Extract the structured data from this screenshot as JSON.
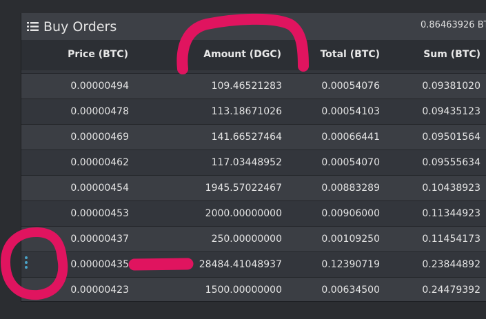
{
  "panel": {
    "title": "Buy Orders",
    "total": "0.86463926 BT",
    "icon": "list-icon"
  },
  "columns": [
    "Price (BTC)",
    "Amount (DGC)",
    "Total (BTC)",
    "Sum (BTC)"
  ],
  "rows": [
    [
      "0.00000494",
      "109.46521283",
      "0.00054076",
      "0.09381020"
    ],
    [
      "0.00000478",
      "113.18671026",
      "0.00054103",
      "0.09435123"
    ],
    [
      "0.00000469",
      "141.66527464",
      "0.00066441",
      "0.09501564"
    ],
    [
      "0.00000462",
      "117.03448952",
      "0.00054070",
      "0.09555634"
    ],
    [
      "0.00000454",
      "1945.57022467",
      "0.00883289",
      "0.10438923"
    ],
    [
      "0.00000453",
      "2000.00000000",
      "0.00906000",
      "0.11344923"
    ],
    [
      "0.00000437",
      "250.00000000",
      "0.00109250",
      "0.11454173"
    ],
    [
      "0.00000435",
      "28484.41048937",
      "0.12390719",
      "0.23844892"
    ],
    [
      "0.00000423",
      "1500.00000000",
      "0.00634500",
      "0.24479392"
    ]
  ],
  "colors": {
    "background": "#2b2d31",
    "header": "#3d4046",
    "row_odd": "#3b3e44",
    "row_even": "#33363c",
    "handle": "#4aa3c8",
    "annotation": "#e0145f"
  },
  "side_handle_icon": "drag-handle-icon"
}
